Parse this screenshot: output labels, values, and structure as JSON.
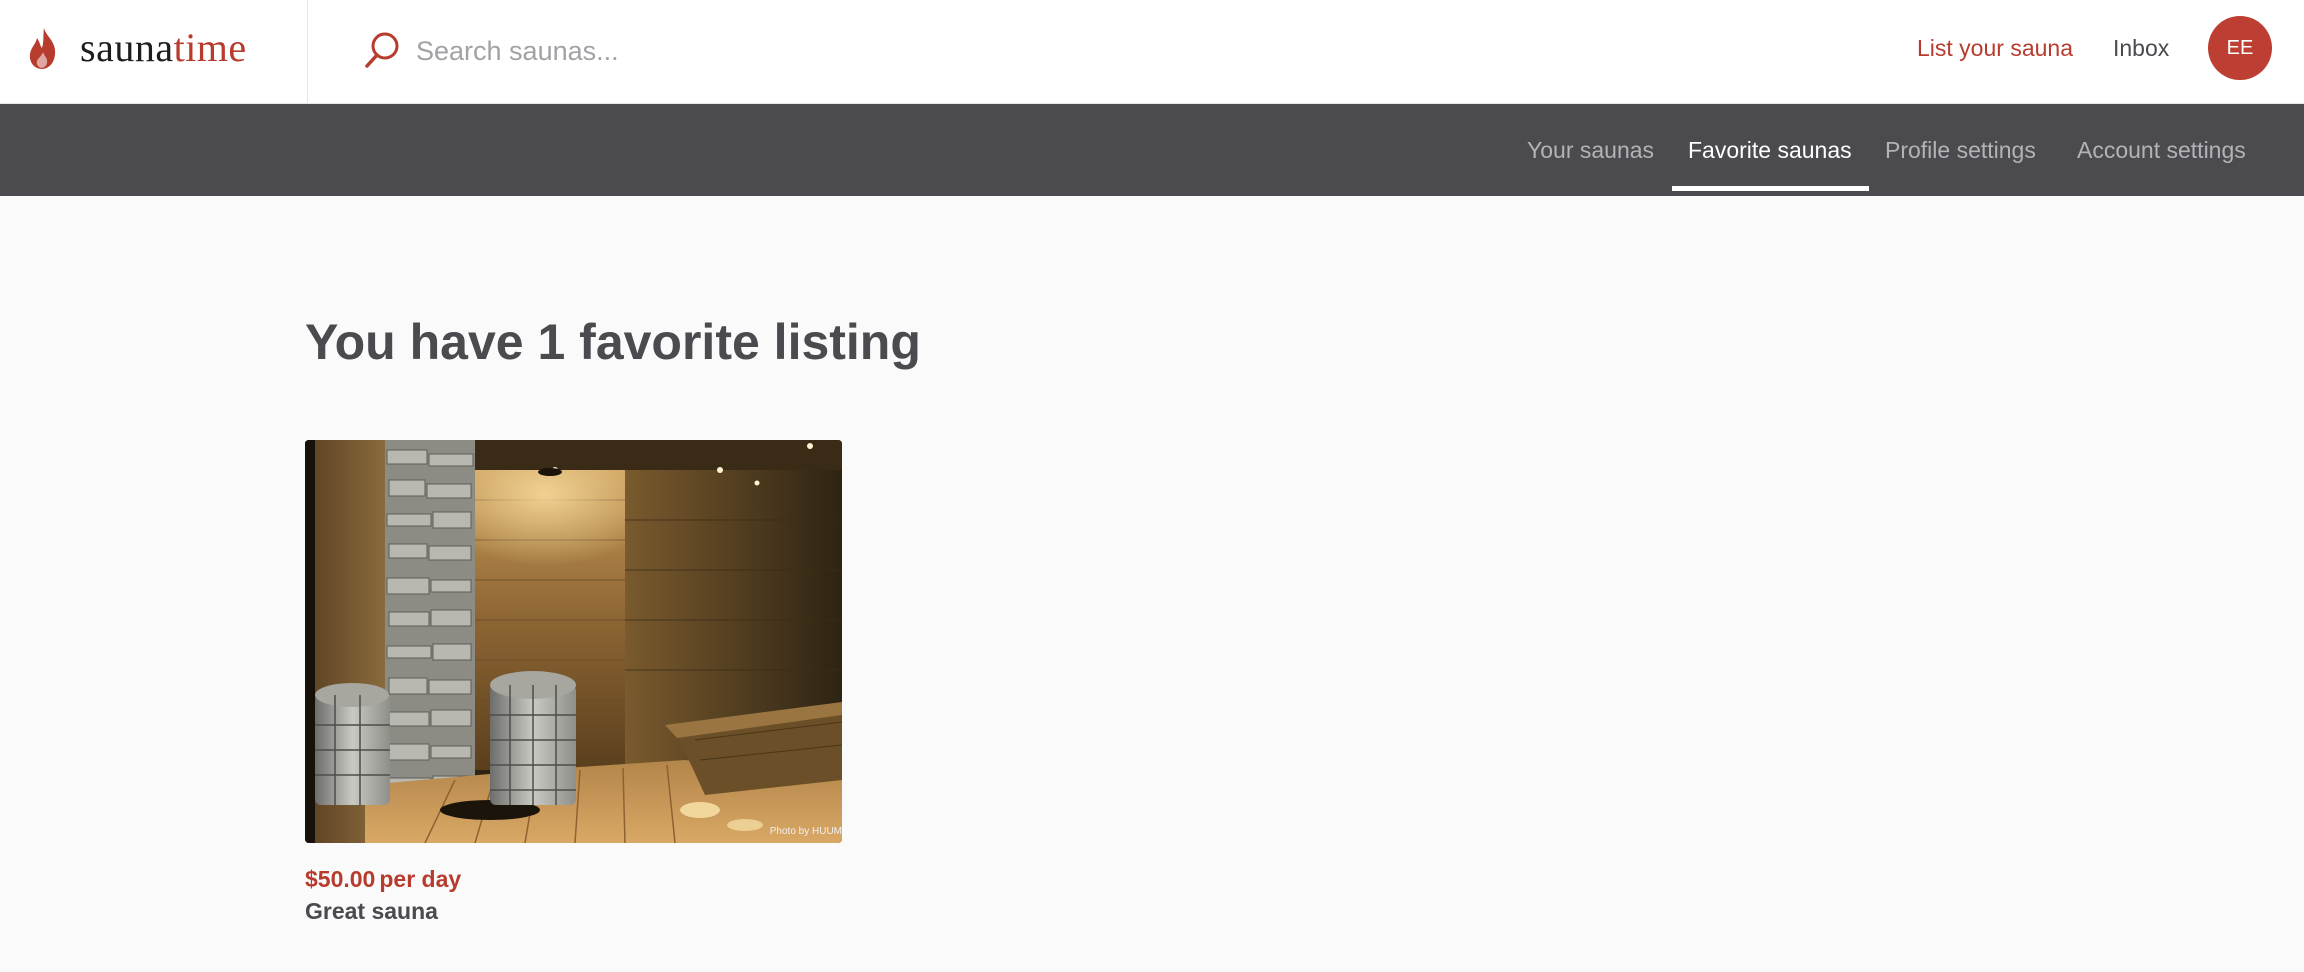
{
  "header": {
    "logo": {
      "part1": "sauna",
      "part2": "time"
    },
    "search": {
      "placeholder": "Search saunas...",
      "value": ""
    },
    "list_sauna_label": "List your sauna",
    "inbox_label": "Inbox",
    "avatar_initials": "EE"
  },
  "subnav": {
    "tabs": [
      {
        "label": "Your saunas",
        "active": false
      },
      {
        "label": "Favorite saunas",
        "active": true
      },
      {
        "label": "Profile settings",
        "active": false
      },
      {
        "label": "Account settings",
        "active": false
      }
    ]
  },
  "main": {
    "title": "You have 1 favorite listing",
    "listings": [
      {
        "price": "$50.00",
        "price_unit": "per day",
        "title": "Great sauna",
        "photo_credit": "Photo by HUUM"
      }
    ]
  },
  "colors": {
    "brand": "#b73c2e",
    "subnav_bg": "#4a4a4f",
    "page_bg": "#fafafa"
  }
}
